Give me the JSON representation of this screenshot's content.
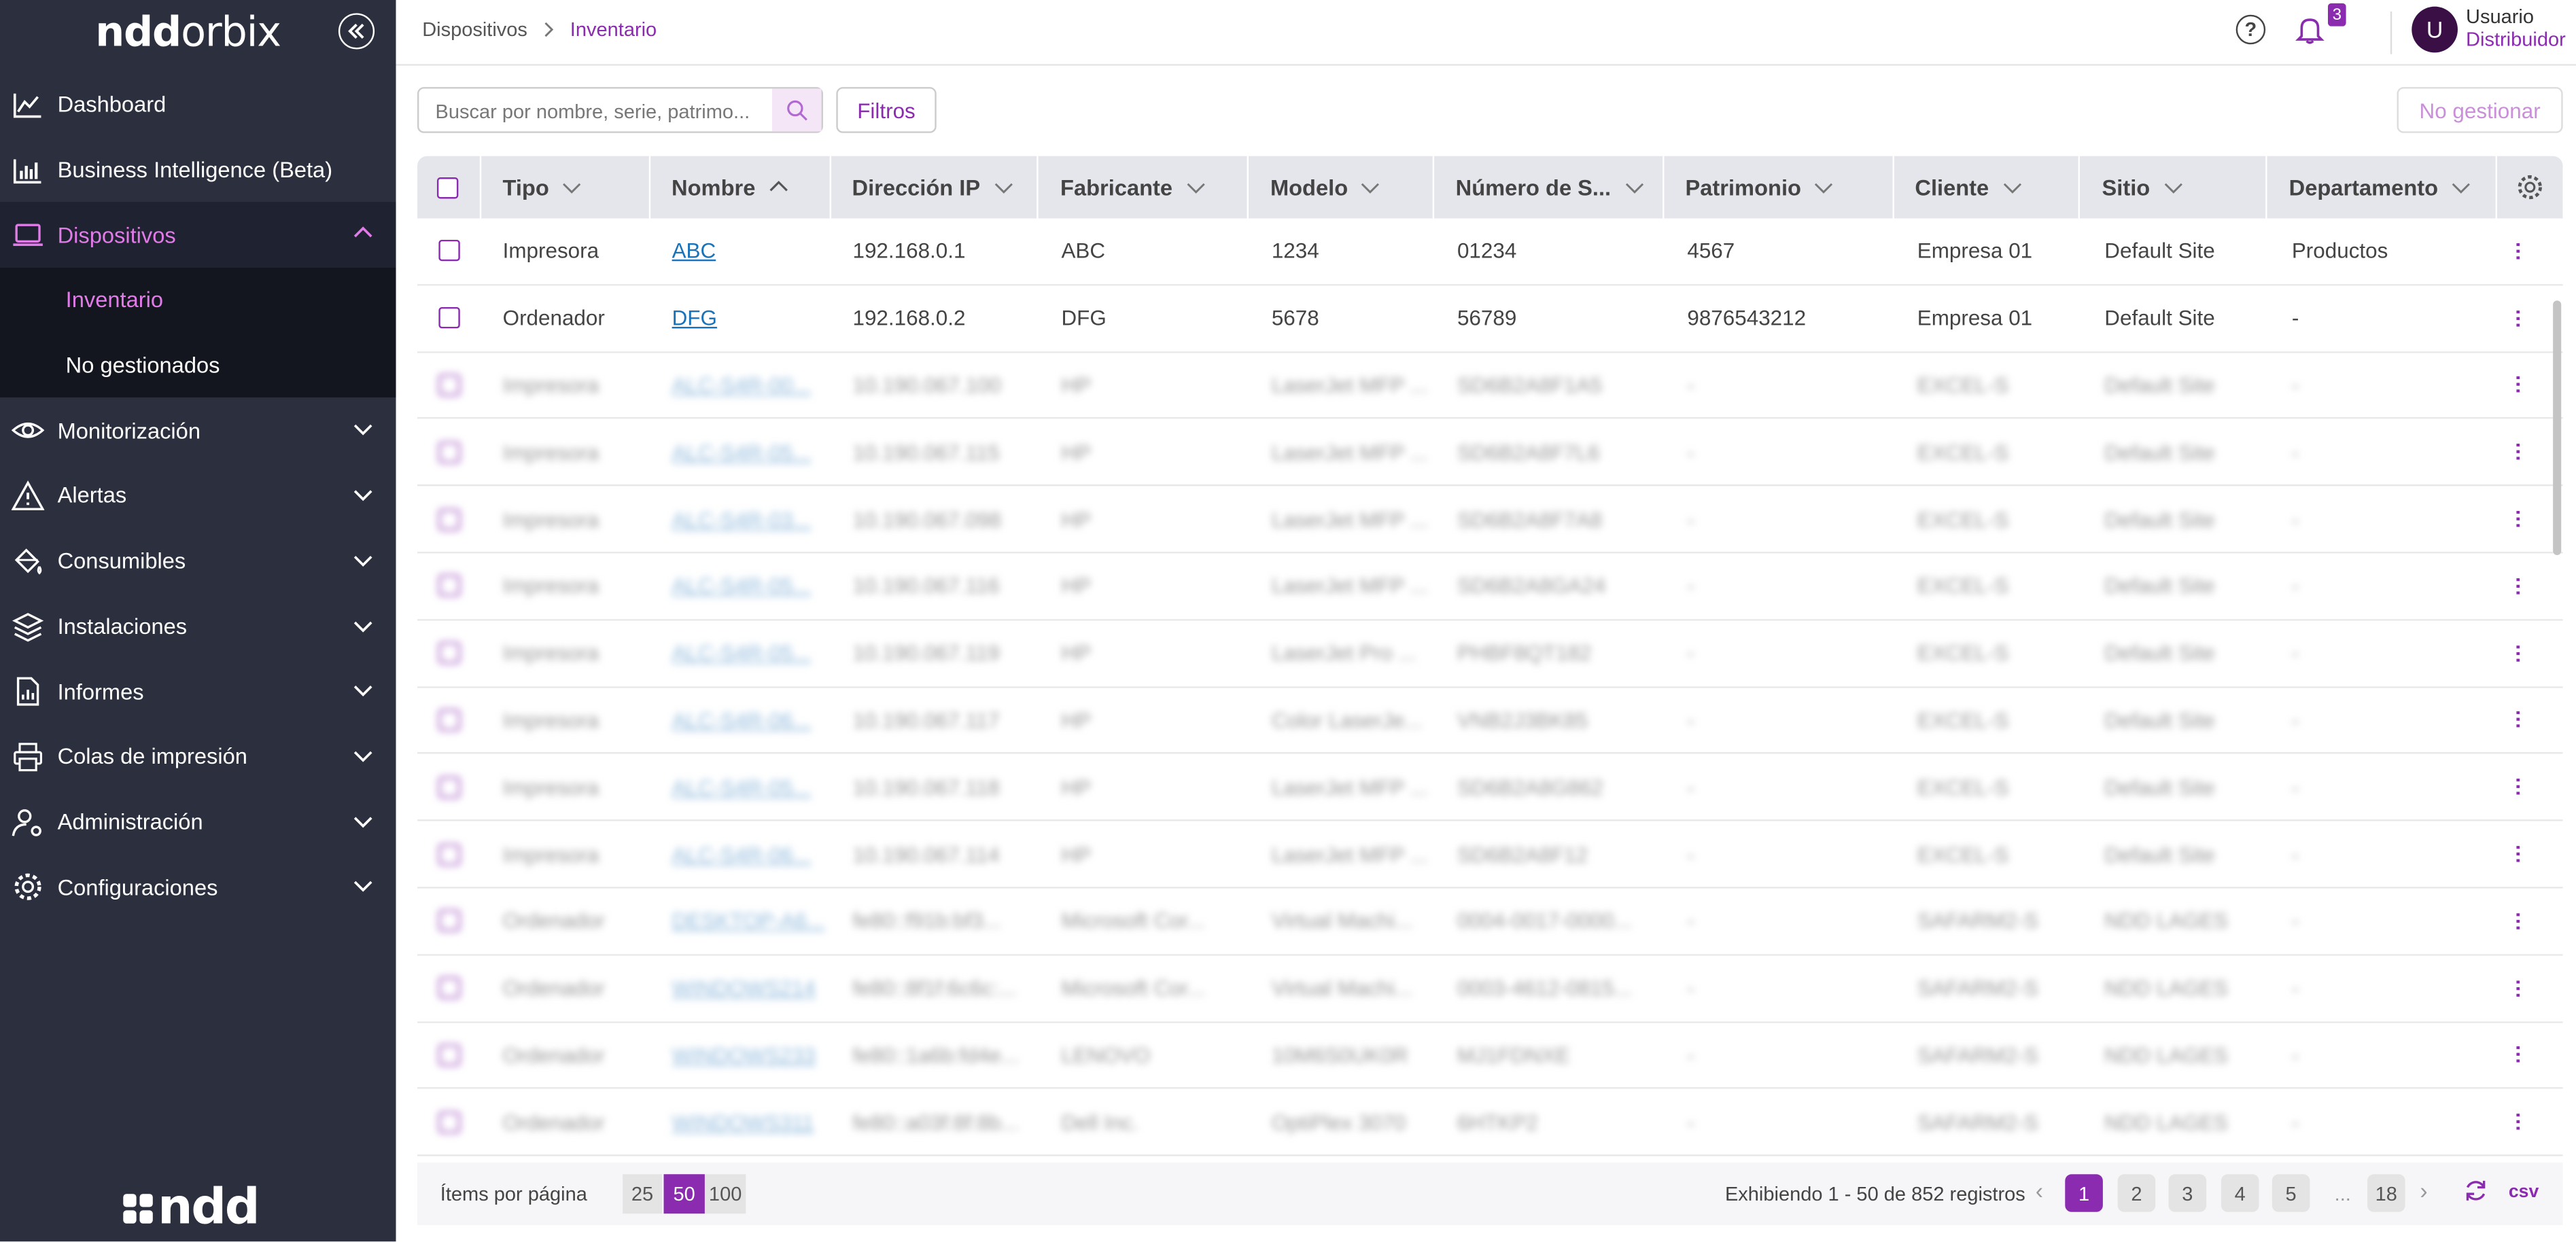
{
  "sidebar": {
    "logo": {
      "bold": "ndd",
      "thin": "orbix"
    },
    "footer_logo": "ndd",
    "items": [
      {
        "label": "Dashboard",
        "icon": "chart-line-icon"
      },
      {
        "label": "Business Intelligence (Beta)",
        "icon": "bar-chart-icon"
      },
      {
        "label": "Dispositivos",
        "icon": "laptop-icon"
      },
      {
        "label": "Inventario"
      },
      {
        "label": "No gestionados"
      },
      {
        "label": "Monitorización",
        "icon": "eye-icon"
      },
      {
        "label": "Alertas",
        "icon": "warning-icon"
      },
      {
        "label": "Consumibles",
        "icon": "paint-bucket-icon"
      },
      {
        "label": "Instalaciones",
        "icon": "layers-icon"
      },
      {
        "label": "Informes",
        "icon": "report-icon"
      },
      {
        "label": "Colas de impresión",
        "icon": "printer-icon"
      },
      {
        "label": "Administración",
        "icon": "user-gear-icon"
      },
      {
        "label": "Configuraciones",
        "icon": "gear-icon"
      }
    ]
  },
  "breadcrumb": {
    "parent": "Dispositivos",
    "current": "Inventario"
  },
  "header": {
    "notifications_count": "3",
    "user_initial": "U",
    "user_name": "Usuario",
    "user_role": "Distribuidor",
    "help_label": "?"
  },
  "toolbar": {
    "search_placeholder": "Buscar por nombre, serie, patrimo...",
    "filters_label": "Filtros",
    "unmanaged_label": "No gestionar"
  },
  "table": {
    "columns": [
      "Tipo",
      "Nombre",
      "Dirección IP",
      "Fabricante",
      "Modelo",
      "Número de S...",
      "Patrimonio",
      "Cliente",
      "Sitio",
      "Departamento"
    ],
    "rows": [
      [
        "Impresora",
        "ABC",
        "192.168.0.1",
        "ABC",
        "1234",
        "01234",
        "4567",
        "Empresa 01",
        "Default Site",
        "Productos"
      ],
      [
        "Ordenador",
        "DFG",
        "192.168.0.2",
        "DFG",
        "5678",
        "56789",
        "9876543212",
        "Empresa 01",
        "Default Site",
        "-"
      ],
      [
        "Impresora",
        "ALC-S4R-00...",
        "10.190.067.100",
        "HP",
        "LaserJet MFP ...",
        "SD6B2A8F1A5",
        "-",
        "EXCEL-S",
        "Default Site",
        "-"
      ],
      [
        "Impresora",
        "ALC-S4R-05...",
        "10.190.067.115",
        "HP",
        "LaserJet MFP ...",
        "SD6B2A8F7L6",
        "-",
        "EXCEL-S",
        "Default Site",
        "-"
      ],
      [
        "Impresora",
        "ALC-S4R-03...",
        "10.190.067.098",
        "HP",
        "LaserJet MFP ...",
        "SD6B2A8F7A8",
        "-",
        "EXCEL-S",
        "Default Site",
        "-"
      ],
      [
        "Impresora",
        "ALC-S4R-05...",
        "10.190.067.116",
        "HP",
        "LaserJet MFP ...",
        "SD6B2A8GA24",
        "-",
        "EXCEL-S",
        "Default Site",
        "-"
      ],
      [
        "Impresora",
        "ALC-S4R-05...",
        "10.190.067.119",
        "HP",
        "LaserJet Pro ...",
        "PHBF8QT182",
        "-",
        "EXCEL-S",
        "Default Site",
        "-"
      ],
      [
        "Impresora",
        "ALC-S4R-06...",
        "10.190.067.117",
        "HP",
        "Color LaserJe...",
        "VNB2J3BK85",
        "-",
        "EXCEL-S",
        "Default Site",
        "-"
      ],
      [
        "Impresora",
        "ALC-S4R-05...",
        "10.190.067.118",
        "HP",
        "LaserJet MFP ...",
        "SD6B2A8G862",
        "-",
        "EXCEL-S",
        "Default Site",
        "-"
      ],
      [
        "Impresora",
        "ALC-S4R-06...",
        "10.190.067.114",
        "HP",
        "LaserJet MFP ...",
        "SD6B2A8F12",
        "-",
        "EXCEL-S",
        "Default Site",
        "-"
      ],
      [
        "Ordenador",
        "DESKTOP-A6...",
        "fe80::f91b:bf3...",
        "Microsoft Cor...",
        "Virtual Machi...",
        "0004-0017-0000...",
        "-",
        "SAFARM2-S",
        "NDD LAGES",
        "-"
      ],
      [
        "Ordenador",
        "WINDOWS214",
        "fe80::8f1f:6c6c:...",
        "Microsoft Cor...",
        "Virtual Machi...",
        "0003-4612-0815...",
        "-",
        "SAFARM2-S",
        "NDD LAGES",
        "-"
      ],
      [
        "Ordenador",
        "WINDOWS233",
        "fe80::1a6b:fd4e...",
        "LENOVO",
        "10M6S0UK0R",
        "MJ1FDNXE",
        "-",
        "SAFARM2-S",
        "NDD LAGES",
        "-"
      ],
      [
        "Ordenador",
        "WINDOWS311",
        "fe80::a03f:8f:8b...",
        "Dell Inc.",
        "OptiPlex 3070",
        "6HTKP2",
        "-",
        "SAFARM2-S",
        "NDD LAGES",
        "-"
      ]
    ]
  },
  "pagination": {
    "items_per_page_label": "Ítems por página",
    "sizes": [
      "25",
      "50",
      "100"
    ],
    "selected_size": "50",
    "showing_text": "Exhibiendo  1 - 50 de 852 registros",
    "pages": [
      "1",
      "2",
      "3",
      "4",
      "5"
    ],
    "ellipsis": "...",
    "last_page": "18",
    "current_page": "1",
    "csv_label": "csv"
  },
  "colors": {
    "accent": "#8a2bb0",
    "sidebar_bg": "#2b2f3e",
    "active_text": "#e07be8"
  }
}
